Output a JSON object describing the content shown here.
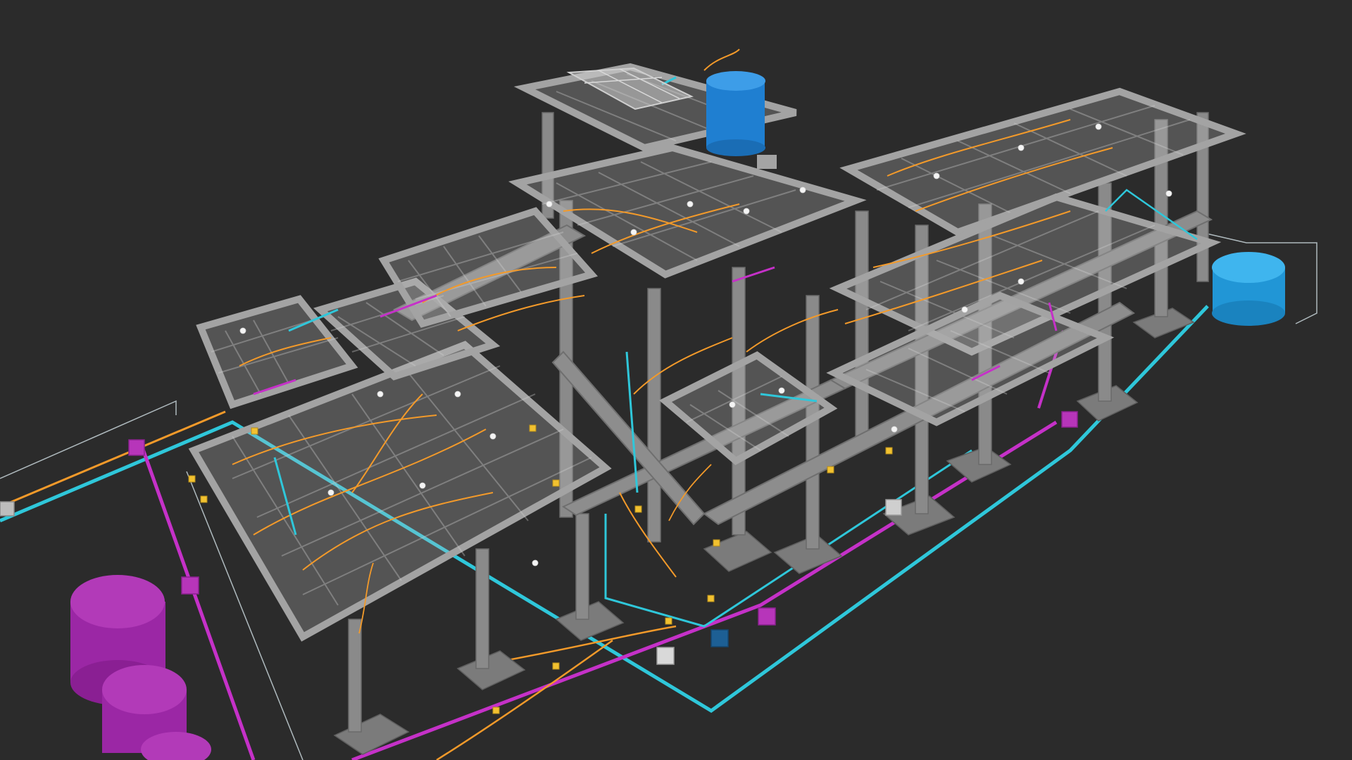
{
  "viewer": {
    "background": "#2b2b2b"
  },
  "model": {
    "structure_color": "#8d8d8d",
    "slab_color": "#bebebe",
    "water_pipe_color": "#2fc7da",
    "sewer_pipe_color": "#c531c8",
    "electrical_color": "#f39a2a",
    "water_tank_color": "#2d8fe0",
    "ground_tank_color": "#29a7e8",
    "septic_tank_color": "#a62eb0",
    "junction_box_color": "#f2c230"
  },
  "icons": {
    "water_tank": "cylinder-icon",
    "septic_tank": "cylinder-icon",
    "junction_box": "square-icon"
  }
}
